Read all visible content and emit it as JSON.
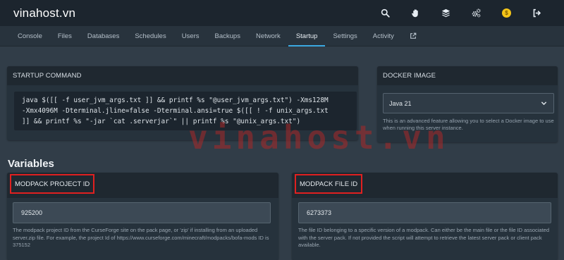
{
  "brand": "vinahost.vn",
  "top_icons": [
    "search-icon",
    "hand-icon",
    "layers-icon",
    "cogs-icon",
    "coin-icon",
    "logout-icon"
  ],
  "nav": {
    "tabs": [
      "Console",
      "Files",
      "Databases",
      "Schedules",
      "Users",
      "Backups",
      "Network",
      "Startup",
      "Settings",
      "Activity"
    ],
    "active": "Startup"
  },
  "startup": {
    "title": "STARTUP COMMAND",
    "command": "java $([[ -f user_jvm_args.txt ]] && printf %s \"@user_jvm_args.txt\") -Xms128M\n-Xmx4096M -Dterminal.jline=false -Dterminal.ansi=true $([[ ! -f unix_args.txt\n]] && printf %s \"-jar `cat .serverjar`\" || printf %s \"@unix_args.txt\")"
  },
  "docker": {
    "title": "DOCKER IMAGE",
    "selected": "Java 21",
    "hint": "This is an advanced feature allowing you to select a Docker image to use when running this server instance."
  },
  "variables_title": "Variables",
  "variables": [
    {
      "label": "MODPACK PROJECT ID",
      "value": "925200",
      "description": "The modpack project ID from the CurseForge site on the pack page, or 'zip' if installing from an uploaded server.zip file. For example, the project Id of https://www.curseforge.com/minecraft/modpacks/bofa-mods ID is 375152"
    },
    {
      "label": "MODPACK FILE ID",
      "value": "6273373",
      "description": "The file ID belonging to a specific version of a modpack. Can either be the main file or the file ID associated with the server pack. If not provided the script will attempt to retrieve the latest server pack or client pack available."
    }
  ],
  "watermark": "vinahost.vn",
  "colors": {
    "accent": "#3aa8e0",
    "highlight": "#e02020",
    "coin": "#f5c518"
  }
}
